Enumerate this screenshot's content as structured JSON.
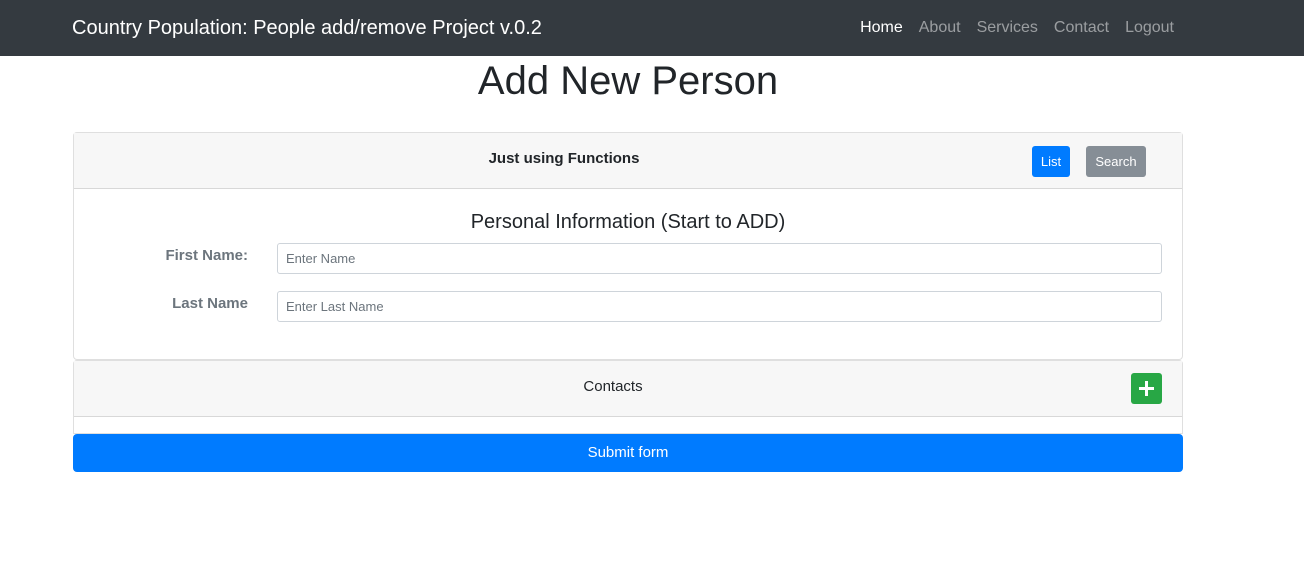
{
  "navbar": {
    "brand": "Country Population: People add/remove Project v.0.2",
    "links": [
      "Home",
      "About",
      "Services",
      "Contact",
      "Logout"
    ],
    "active": "Home"
  },
  "page": {
    "title": "Add New Person"
  },
  "card": {
    "header_title": "Just using Functions",
    "list_label": "List",
    "search_label": "Search"
  },
  "personal": {
    "title": "Personal Information (Start to ADD)",
    "first_name_label": "First Name:",
    "first_name_placeholder": "Enter Name",
    "first_name_value": "",
    "last_name_label": "Last Name",
    "last_name_placeholder": "Enter Last Name",
    "last_name_value": ""
  },
  "contacts": {
    "title": "Contacts",
    "add_icon": "plus-icon"
  },
  "submit": {
    "label": "Submit form"
  },
  "colors": {
    "navbar": "#343a40",
    "primary": "#007bff",
    "secondary": "#868e96",
    "success": "#28a745"
  }
}
